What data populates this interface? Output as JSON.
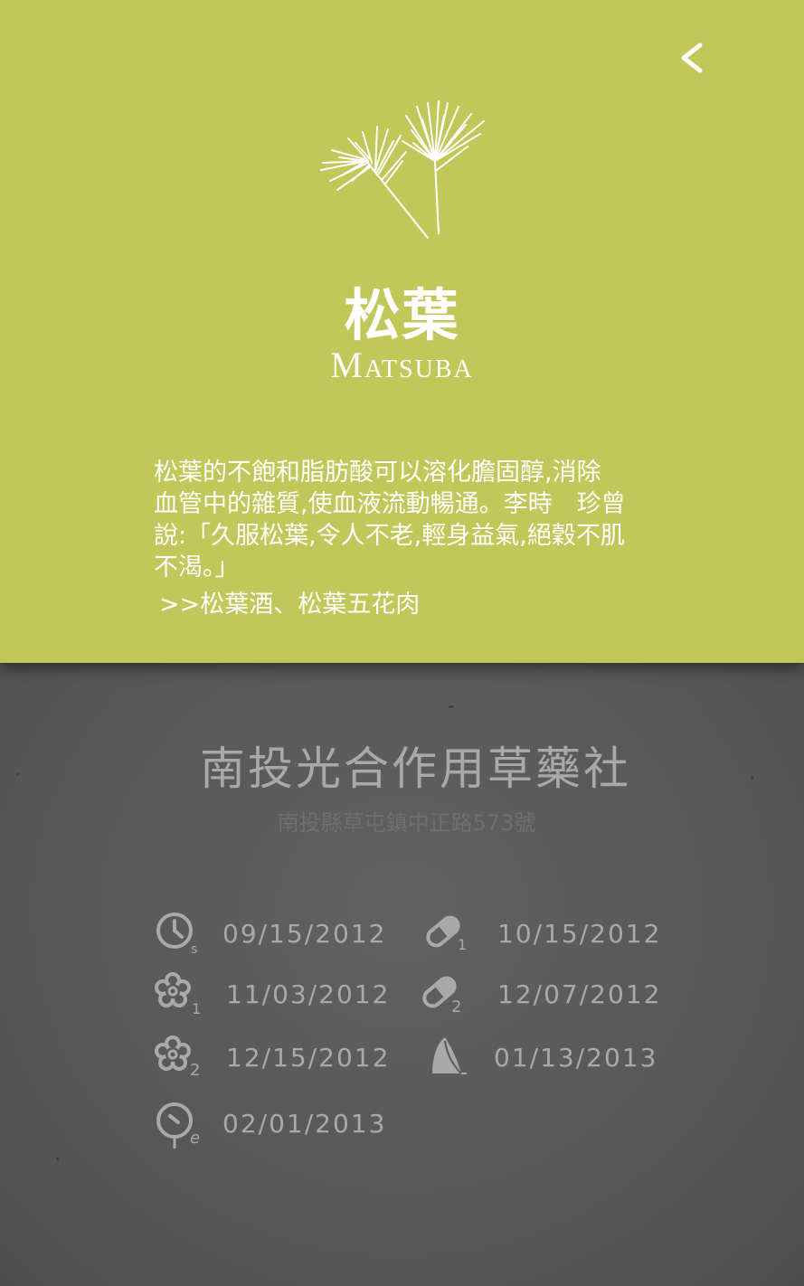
{
  "header": {
    "back_icon": "chevron-left-icon",
    "illustration_icon": "pine-needles-icon",
    "title": "松葉",
    "subtitle": "Matsuba",
    "description": "松葉的不飽和脂肪酸可以溶化膽固醇,消除\n血管中的雜質,使血液流動暢通。李時　珍曾\n說:「久服松葉,令人不老,輕身益氣,絕穀不肌\n不渴。」",
    "recipes_link": ">>松葉酒、松葉五花肉",
    "background_color": "#c1c758"
  },
  "shop": {
    "name": "南投光合作用草藥社",
    "address": "南投縣草屯鎮中正路573號"
  },
  "timeline": [
    {
      "icon": "clock-start-icon",
      "sub": "s",
      "date": "09/15/2012"
    },
    {
      "icon": "capsule-1-icon",
      "sub": "1",
      "date": "10/15/2012"
    },
    {
      "icon": "flower-1-icon",
      "sub": "1",
      "date": "11/03/2012"
    },
    {
      "icon": "capsule-2-icon",
      "sub": "2",
      "date": "12/07/2012"
    },
    {
      "icon": "flower-2-icon",
      "sub": "2",
      "date": "12/15/2012"
    },
    {
      "icon": "leaf-icon",
      "sub": "",
      "date": "01/13/2013"
    },
    {
      "icon": "clock-end-icon",
      "sub": "e",
      "date": "02/01/2013"
    }
  ]
}
